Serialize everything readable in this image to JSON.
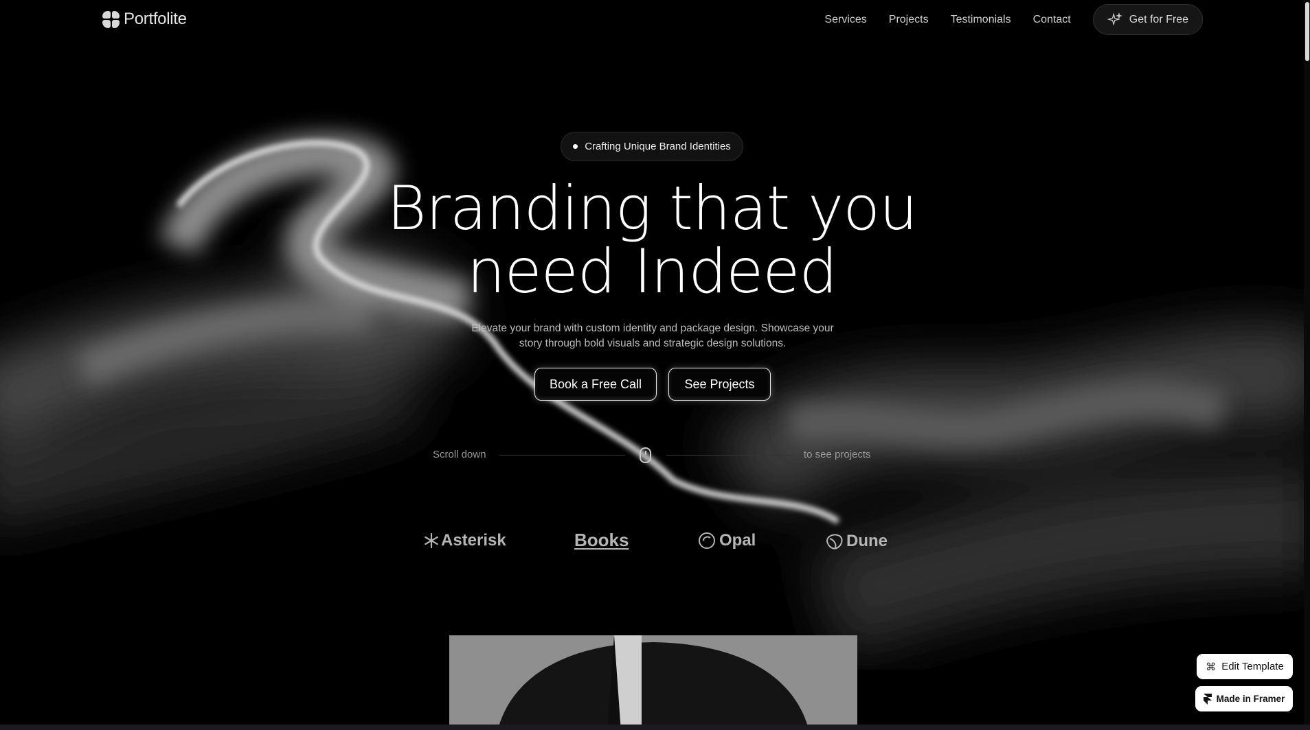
{
  "nav": {
    "brand": "Portfolite",
    "links": [
      "Services",
      "Projects",
      "Testimonials",
      "Contact"
    ],
    "cta_label": "Get for Free"
  },
  "hero": {
    "pill_label": "Crafting Unique Brand Identities",
    "headline_line1": "Branding that you",
    "headline_line2": "need Indeed",
    "subtitle": "Elevate your brand with custom identity and package design. Showcase your story through bold visuals and strategic design solutions.",
    "primary_button": "Book a Free Call",
    "secondary_button": "See Projects",
    "scroll_left": "Scroll down",
    "scroll_right": "to see projects"
  },
  "brands": [
    "Asterisk",
    "Books",
    "Opal",
    "Dune"
  ],
  "badges": {
    "edit_template": "Edit Template",
    "made_in_framer": "Made in Framer"
  },
  "colors": {
    "background": "#000000",
    "text": "#ffffff",
    "muted": "#bdbdbd"
  }
}
